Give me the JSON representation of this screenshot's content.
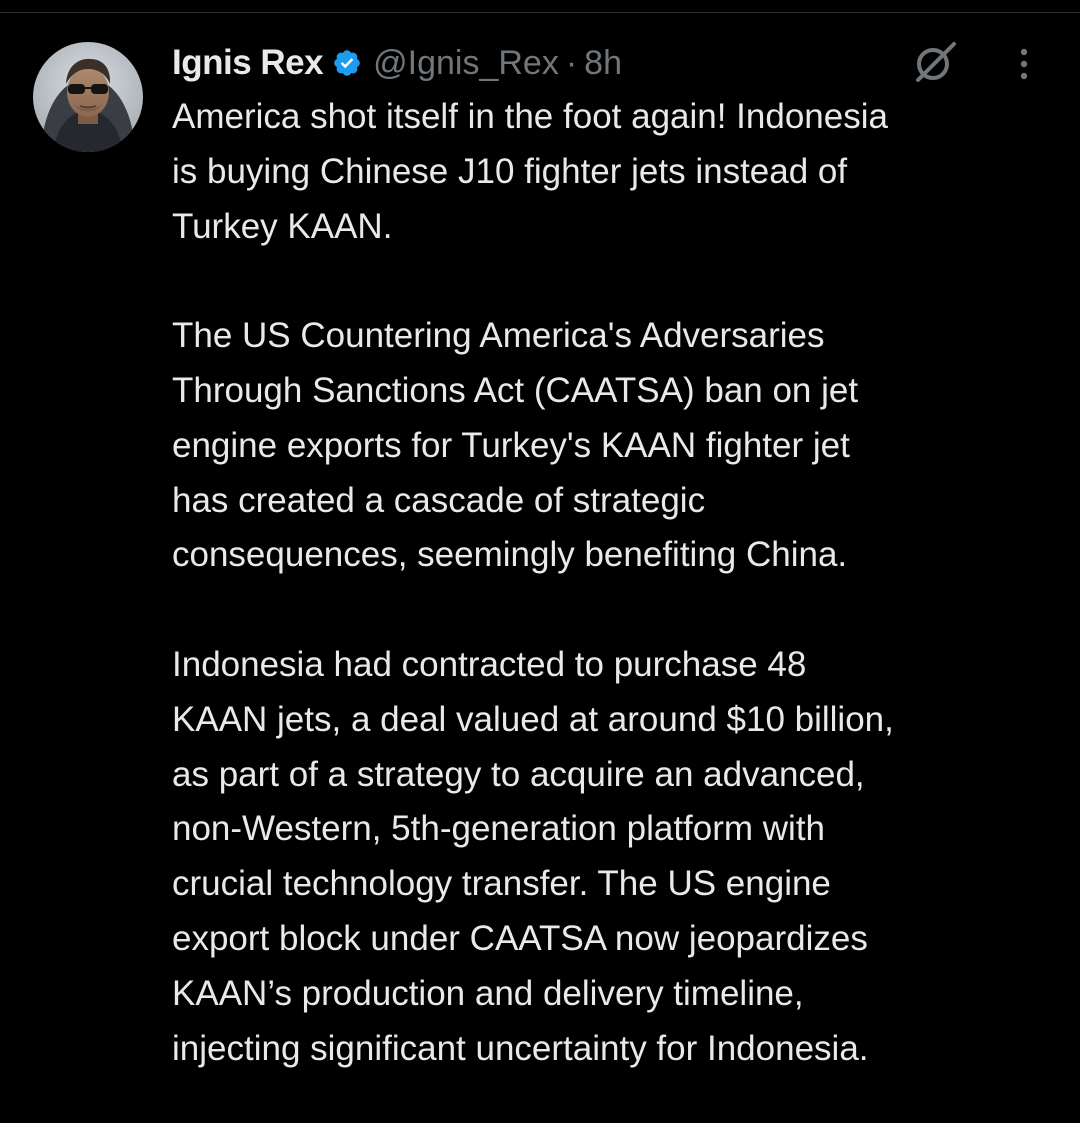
{
  "tweet": {
    "author": {
      "display_name": "Ignis Rex",
      "handle": "@Ignis_Rex",
      "separator": "·",
      "time_ago": "8h",
      "verified_icon": "verified-badge-icon",
      "avatar_icon": "avatar"
    },
    "actions": {
      "grok_icon": "grok-icon",
      "more_icon": "more-options-icon"
    },
    "paragraphs": [
      {
        "lines": [
          "America shot itself in the foot again! Indonesia",
          "is buying Chinese J10 fighter jets instead of",
          "Turkey KAAN."
        ]
      },
      {
        "lines": [
          "The US Countering America's Adversaries",
          "Through Sanctions Act (CAATSA) ban on jet",
          "engine exports for Turkey's KAAN fighter jet",
          "has created a cascade of strategic",
          "consequences, seemingly benefiting China."
        ]
      },
      {
        "lines": [
          "Indonesia had contracted to purchase 48",
          "KAAN jets, a deal valued at around $10 billion,",
          "as part of a strategy to acquire an advanced,",
          "non-Western, 5th-generation platform with",
          "crucial technology transfer. The US engine",
          "export block under CAATSA now jeopardizes",
          "KAAN’s production and delivery timeline,",
          "injecting significant uncertainty for Indonesia."
        ]
      }
    ]
  },
  "colors": {
    "background": "#000000",
    "text": "#e7e9ea",
    "secondary_text": "#71767b",
    "verified_blue": "#1d9bf0",
    "divider": "#2f3336"
  }
}
